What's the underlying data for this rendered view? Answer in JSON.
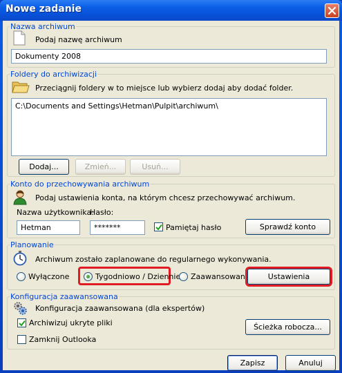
{
  "window": {
    "title": "Nowe zadanie"
  },
  "archive_name": {
    "legend": "Nazwa archiwum",
    "hint": "Podaj nazwę archiwum",
    "value": "Dokumenty 2008"
  },
  "folders": {
    "legend": "Foldery do archiwizacji",
    "hint": "Przeciągnij foldery w to miejsce lub wybierz dodaj aby dodać folder.",
    "items": [
      "C:\\Documents and Settings\\Hetman\\Pulpit\\archiwum\\"
    ],
    "add_label": "Dodaj...",
    "change_label": "Zmień...",
    "remove_label": "Usuń..."
  },
  "account": {
    "legend": "Konto do przechowywania archiwum",
    "hint": "Podaj ustawienia konta, na którym chcesz przechowywać archiwum.",
    "username_label": "Nazwa użytkownika:",
    "password_label": "Hasło:",
    "username_value": "Hetman",
    "password_value": "*******",
    "remember_label": "Pamiętaj hasło",
    "remember_checked": true,
    "check_label": "Sprawdź konto"
  },
  "schedule": {
    "legend": "Planowanie",
    "hint": "Archiwum zostało zaplanowane do regularnego wykonywania.",
    "off_label": "Wyłączone",
    "weekly_label": "Tygodniowo / Dziennie",
    "advanced_label": "Zaawansowane",
    "selected": "weekly",
    "settings_label": "Ustawienia",
    "highlight_color": "#e01b24"
  },
  "advanced": {
    "legend": "Konfiguracja zaawansowana",
    "hint": "Konfiguracja zaawansowana (dla ekspertów)",
    "hidden_label": "Archiwizuj ukryte pliki",
    "hidden_checked": true,
    "outlook_label": "Zamknij Outlooka",
    "outlook_checked": false,
    "workdir_label": "Ścieżka robocza..."
  },
  "footer": {
    "save_label": "Zapisz",
    "cancel_label": "Anuluj"
  },
  "colors": {
    "titlebar": "#0b5fe6",
    "dialog_bg": "#ece9d8",
    "group_label": "#0046d5"
  }
}
